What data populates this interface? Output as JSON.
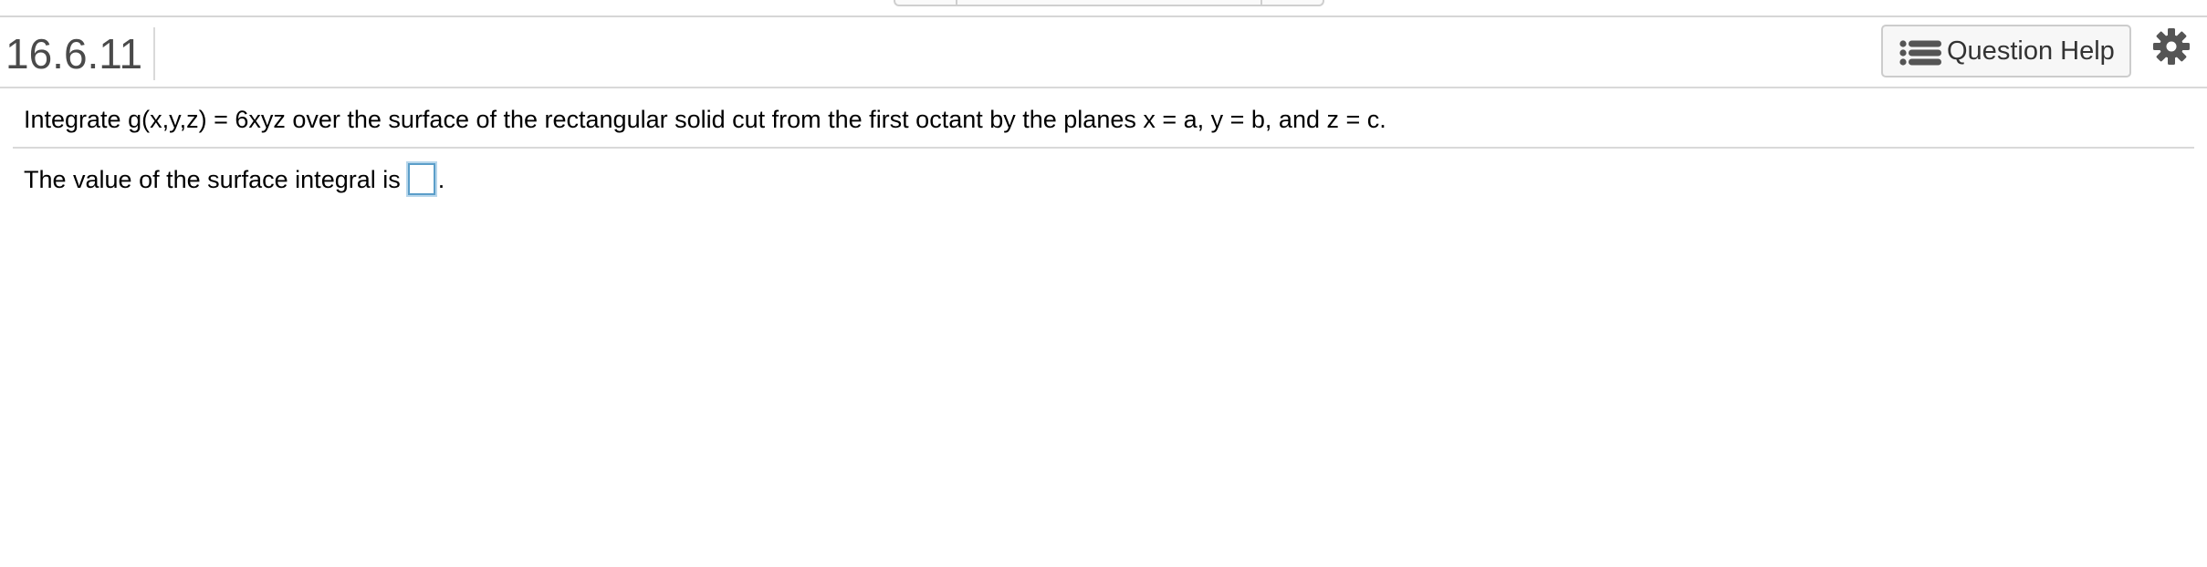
{
  "header": {
    "question_id": "16.6.11",
    "help_button_label": "Question Help",
    "help_icon": "list-icon",
    "settings_icon": "gear-icon"
  },
  "question": {
    "stem": "Integrate g(x,y,z) = 6xyz over the surface of the rectangular solid cut from the first octant by the planes x = a, y = b, and z = c.",
    "answer_prefix": "The value of the surface integral is",
    "answer_value": "",
    "answer_suffix": "."
  },
  "colors": {
    "answer_box_border": "#5b9ec9",
    "header_text": "#4a4a4a",
    "icon_gray": "#555555"
  }
}
